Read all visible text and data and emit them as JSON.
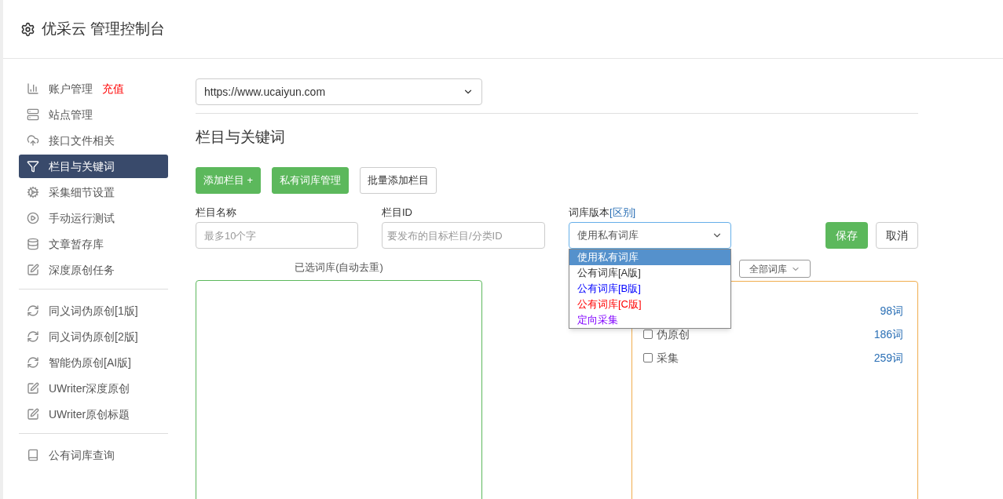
{
  "header": {
    "title": "优采云 管理控制台"
  },
  "sidebar": {
    "groups": [
      {
        "items": [
          {
            "label": "账户管理",
            "badge": "充值",
            "selected": false
          },
          {
            "label": "站点管理",
            "selected": false
          },
          {
            "label": "接口文件相关",
            "selected": false
          },
          {
            "label": "栏目与关键词",
            "selected": true
          },
          {
            "label": "采集细节设置",
            "selected": false
          },
          {
            "label": "手动运行测试",
            "selected": false
          },
          {
            "label": "文章暂存库",
            "selected": false
          },
          {
            "label": "深度原创任务",
            "selected": false
          }
        ]
      },
      {
        "items": [
          {
            "label": "同义词伪原创[1版]",
            "selected": false
          },
          {
            "label": "同义词伪原创[2版]",
            "selected": false
          },
          {
            "label": "智能伪原创[AI版]",
            "selected": false
          },
          {
            "label": "UWriter深度原创",
            "selected": false
          },
          {
            "label": "UWriter原创标题",
            "selected": false
          }
        ]
      },
      {
        "items": [
          {
            "label": "公有词库查询",
            "selected": false
          }
        ]
      }
    ]
  },
  "site_select": {
    "value": "https://www.ucaiyun.com"
  },
  "section_title": "栏目与关键词",
  "actions": [
    {
      "label": "添加栏目 +",
      "kind": "primary"
    },
    {
      "label": "私有词库管理",
      "kind": "primary"
    },
    {
      "label": "批量添加栏目",
      "kind": "default"
    }
  ],
  "form": {
    "name_field": {
      "label": "栏目名称",
      "placeholder": "最多10个字"
    },
    "id_field": {
      "label": "栏目ID",
      "placeholder": "要发布的目标栏目/分类ID"
    },
    "version_select": {
      "label": "词库版本",
      "link": "[区别]",
      "value": "使用私有词库",
      "expanded": true,
      "options": [
        {
          "label": "使用私有词库",
          "selected": true
        },
        {
          "label": "公有词库[A版]",
          "selected": false
        },
        {
          "label": "公有词库[B版]",
          "color": "#0000ff",
          "selected": false
        },
        {
          "label": "公有词库[C版]",
          "color": "#ff0000",
          "selected": false
        },
        {
          "label": "定向采集",
          "color": "#8000ff",
          "selected": false
        }
      ]
    },
    "save_button": "保存",
    "cancel_button": "取消"
  },
  "selected_panel": {
    "title": "已选词库(自动去重)"
  },
  "library_panel": {
    "filter": "全部词库",
    "rows": [
      {
        "count": "98词"
      },
      {
        "label": "伪原创",
        "checked": false,
        "count": "186词"
      },
      {
        "label": "采集",
        "checked": false,
        "count": "259词"
      }
    ]
  }
}
